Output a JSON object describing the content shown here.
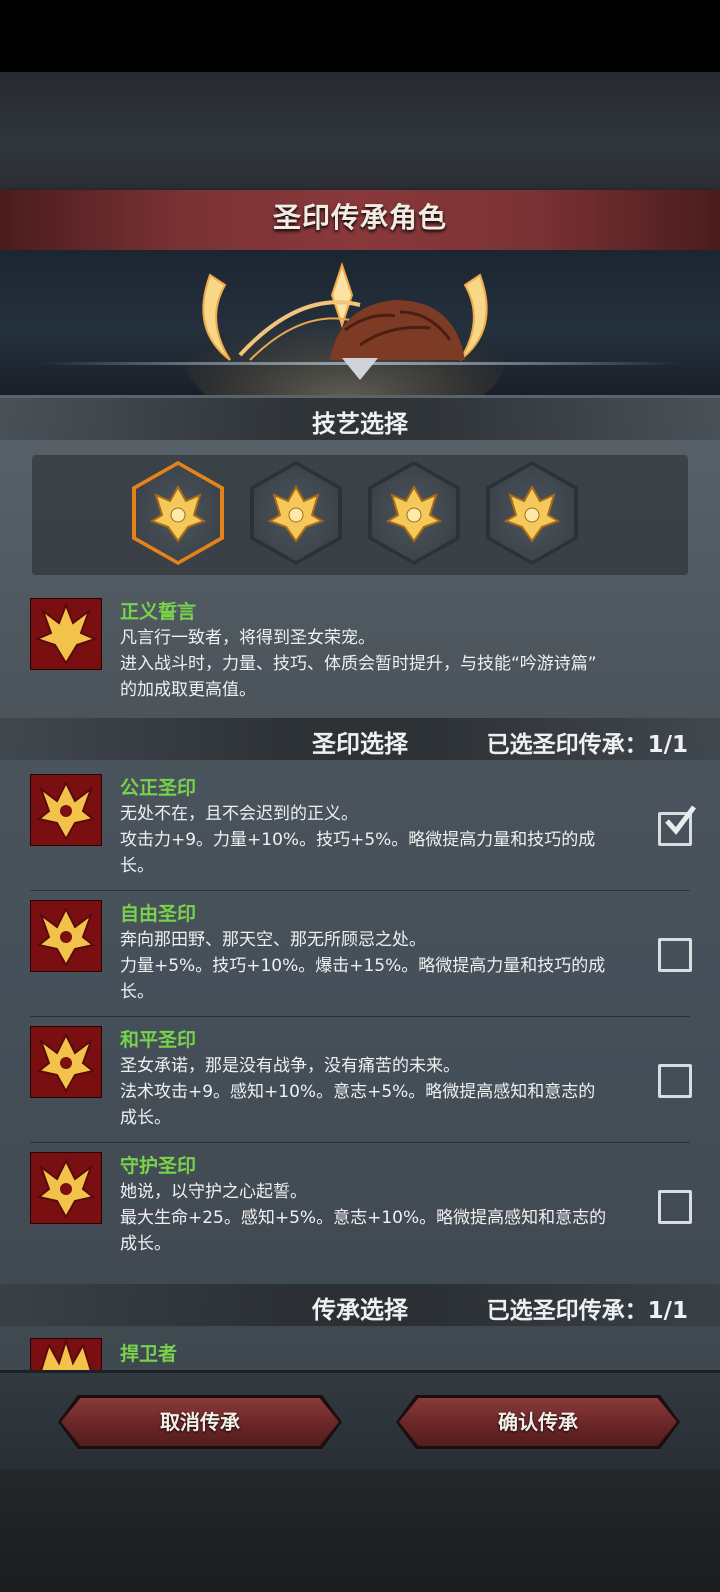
{
  "header": {
    "title": "圣印传承角色"
  },
  "skill_section": {
    "title": "技艺选择",
    "icons": [
      "crest-icon-1",
      "crest-icon-2",
      "crest-icon-3",
      "crest-icon-4"
    ],
    "selected_index": 0
  },
  "skill_detail": {
    "name": "正义誓言",
    "lines": [
      "凡言行一致者，将得到圣女荣宠。",
      "进入战斗时，力量、技巧、体质会暂时提升，与技能“吟游诗篇”",
      "的加成取更高值。"
    ]
  },
  "seal_section": {
    "title": "圣印选择",
    "count_text": "已选圣印传承：1/1",
    "items": [
      {
        "name": "公正圣印",
        "lines": [
          "无处不在，且不会迟到的正义。",
          "攻击力+9。力量+10%。技巧+5%。略微提高力量和技巧的成",
          "长。"
        ],
        "checked": true
      },
      {
        "name": "自由圣印",
        "lines": [
          "奔向那田野、那天空、那无所顾忌之处。",
          "力量+5%。技巧+10%。爆击+15%。略微提高力量和技巧的成",
          "长。"
        ],
        "checked": false
      },
      {
        "name": "和平圣印",
        "lines": [
          "圣女承诺，那是没有战争，没有痛苦的未来。",
          "法术攻击+9。感知+10%。意志+5%。略微提高感知和意志的",
          "成长。"
        ],
        "checked": false
      },
      {
        "name": "守护圣印",
        "lines": [
          "她说，以守护之心起誓。",
          "最大生命+25。感知+5%。意志+10%。略微提高感知和意志的",
          "成长。"
        ],
        "checked": false
      }
    ]
  },
  "inherit_section": {
    "title": "传承选择",
    "count_text": "已选圣印传承：1/1",
    "first_item": "捍卫者"
  },
  "buttons": {
    "cancel": "取消传承",
    "confirm": "确认传承"
  },
  "colors": {
    "accent_orange": "#e4821b",
    "name_green": "#78d24b",
    "title_red": "#7a3134"
  }
}
